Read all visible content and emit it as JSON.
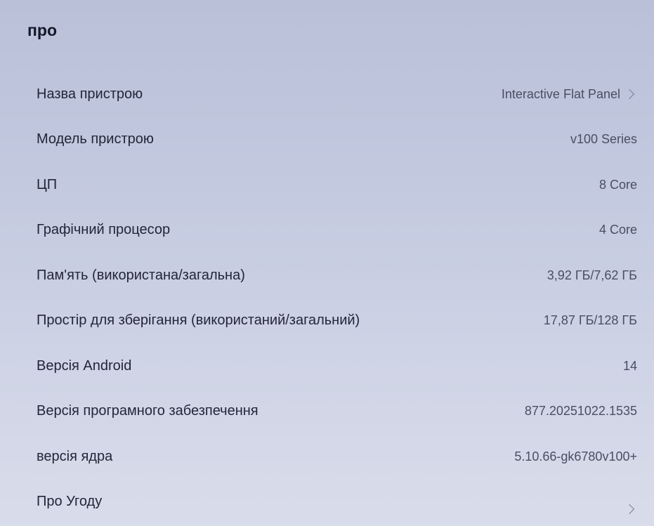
{
  "page": {
    "title": "про"
  },
  "items": [
    {
      "label": "Назва пристрою",
      "value": "Interactive Flat Panel",
      "chevron": true
    },
    {
      "label": "Модель пристрою",
      "value": "v100 Series",
      "chevron": false
    },
    {
      "label": "ЦП",
      "value": "8 Core",
      "chevron": false
    },
    {
      "label": "Графічний процесор",
      "value": "4 Core",
      "chevron": false
    },
    {
      "label": "Пам'ять (використана/загальна)",
      "value": "3,92 ГБ/7,62 ГБ",
      "chevron": false
    },
    {
      "label": "Простір для зберігання (використаний/загальний)",
      "value": "17,87 ГБ/128 ГБ",
      "chevron": false
    },
    {
      "label": "Версія Android",
      "value": "14",
      "chevron": false
    },
    {
      "label": "Версія програмного забезпечення",
      "value": "877.20251022.1535",
      "chevron": false
    },
    {
      "label": "версія ядра",
      "value": "5.10.66-gk6780v100+",
      "chevron": false
    },
    {
      "label": "Про Угоду",
      "value": "",
      "chevron": true
    }
  ],
  "icons": {
    "chevron": "chevron-right-icon"
  }
}
